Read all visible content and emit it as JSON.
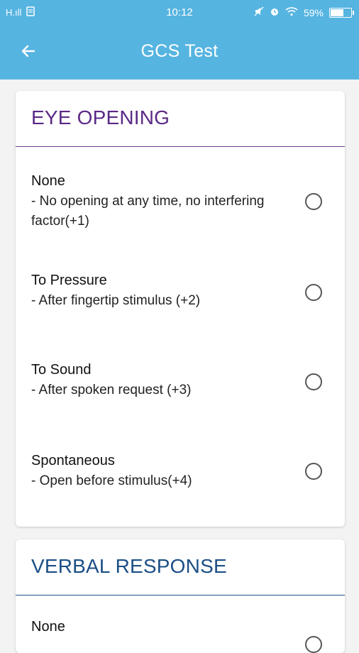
{
  "status_bar": {
    "signal": "H.ıll",
    "time": "10:12",
    "battery_percent": "59%",
    "battery_level": 0.59
  },
  "app_bar": {
    "title": "GCS Test"
  },
  "colors": {
    "primary": "#56b4e0",
    "eye_heading": "#5b2a86",
    "verbal_heading": "#1b4f86"
  },
  "sections": [
    {
      "title": "EYE OPENING",
      "options": [
        {
          "label": "None",
          "description": "- No opening at any time, no interfering factor(+1)"
        },
        {
          "label": "To Pressure",
          "description": "- After fingertip stimulus (+2)"
        },
        {
          "label": "To Sound",
          "description": "- After spoken request (+3)"
        },
        {
          "label": "Spontaneous",
          "description": "- Open before stimulus(+4)"
        }
      ]
    },
    {
      "title": "VERBAL RESPONSE",
      "options": [
        {
          "label": "None"
        }
      ]
    }
  ]
}
